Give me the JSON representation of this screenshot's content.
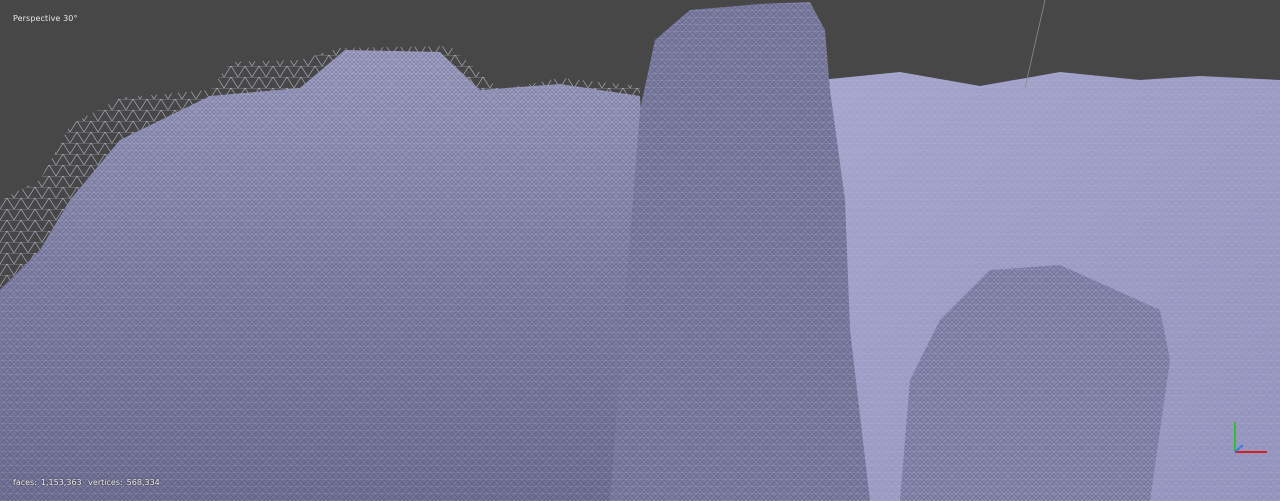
{
  "viewport": {
    "projection_label": "Perspective 30°",
    "background_color": "#474747",
    "mesh_color": "#8e8eb7",
    "wire_color": "#d8d8ee"
  },
  "stats": {
    "faces_label": "faces:",
    "faces_value": "1,153,363",
    "vertices_label": "vertices:",
    "vertices_value": "568,334"
  },
  "axis_gizmo": {
    "x_color": "#d62020",
    "y_color": "#2fbf2f",
    "z_color": "#3c7be0"
  }
}
